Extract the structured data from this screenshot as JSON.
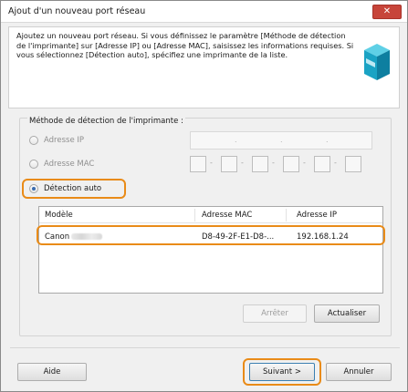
{
  "window": {
    "title": "Ajout d'un nouveau port réseau",
    "close_glyph": "✕"
  },
  "header": {
    "description": "Ajoutez un nouveau port réseau. Si vous définissez le paramètre [Méthode de détection de l'imprimante] sur [Adresse IP] ou [Adresse MAC], saisissez les informations requises. Si vous sélectionnez [Détection auto], spécifiez une imprimante de la liste.",
    "icon": "printer-cube-icon"
  },
  "detection": {
    "group_title": "Méthode de détection de l'imprimante :",
    "options": [
      {
        "label": "Adresse IP",
        "checked": false
      },
      {
        "label": "Adresse MAC",
        "checked": false
      },
      {
        "label": "Détection auto",
        "checked": true
      }
    ],
    "ip_separator": ".",
    "mac_separator": "-"
  },
  "printer_list": {
    "columns": [
      "Modèle",
      "Adresse MAC",
      "Adresse IP"
    ],
    "rows": [
      {
        "model": "Canon",
        "mac": "D8-49-2F-E1-D8-...",
        "ip": "192.168.1.24"
      }
    ]
  },
  "buttons": {
    "stop": "Arrêter",
    "refresh": "Actualiser",
    "help": "Aide",
    "next": "Suivant >",
    "cancel": "Annuler"
  },
  "colors": {
    "highlight": "#e98b18",
    "close": "#c7453a",
    "icon": "#1aa3c4"
  }
}
